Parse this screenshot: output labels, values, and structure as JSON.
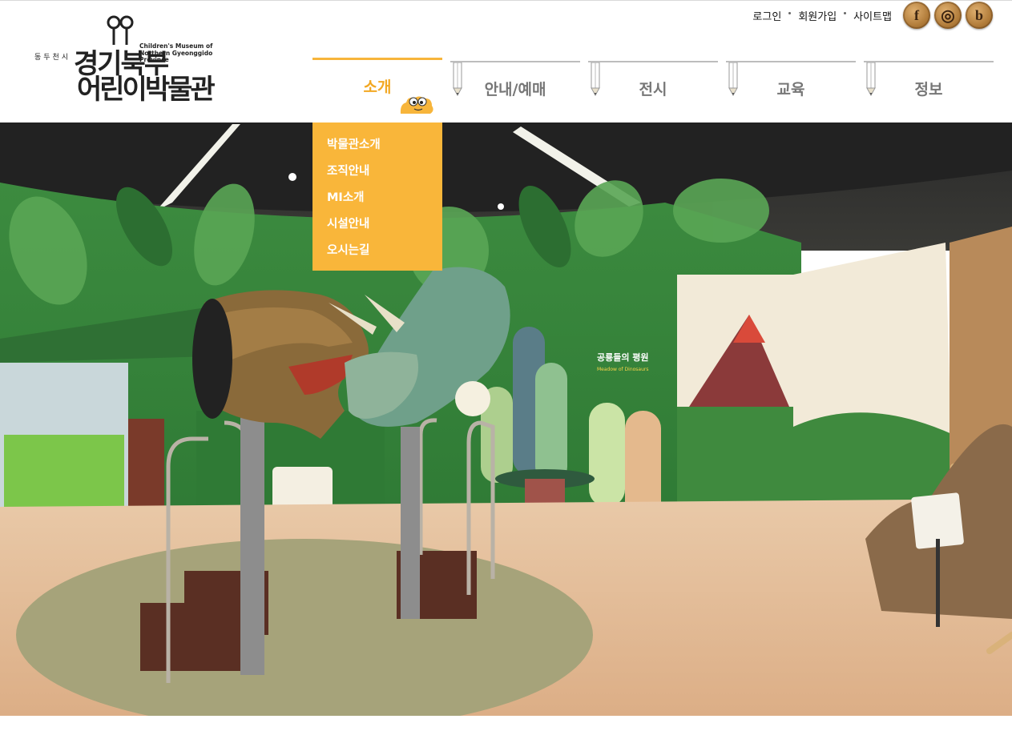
{
  "logo": {
    "city": "동두천시",
    "eng_lines": [
      "Children's Museum of",
      "Northern Gyeonggido",
      "Province"
    ],
    "kr_line1": "경기북부",
    "kr_line2": "어린이박물관"
  },
  "util": {
    "login": "로그인",
    "join": "회원가입",
    "sitemap": "사이트맵"
  },
  "social": [
    {
      "icon": "facebook-icon",
      "glyph": "f"
    },
    {
      "icon": "instagram-icon",
      "glyph": "◎"
    },
    {
      "icon": "blog-icon",
      "glyph": "b"
    }
  ],
  "nav": {
    "items": [
      {
        "label": "소개",
        "active": true
      },
      {
        "label": "안내/예매",
        "active": false
      },
      {
        "label": "전시",
        "active": false
      },
      {
        "label": "교육",
        "active": false
      },
      {
        "label": "정보",
        "active": false
      }
    ]
  },
  "dropdown": {
    "items": [
      "박물관소개",
      "조직안내",
      "MI소개",
      "시설안내",
      "오시는길"
    ]
  },
  "hero": {
    "sign_title": "공룡들의 평원",
    "sign_subtitle": "Meadow of Dinosaurs"
  },
  "colors": {
    "accent": "#f7b53b",
    "nav_inactive": "#777777",
    "wall_green": "#3f8a3e"
  }
}
